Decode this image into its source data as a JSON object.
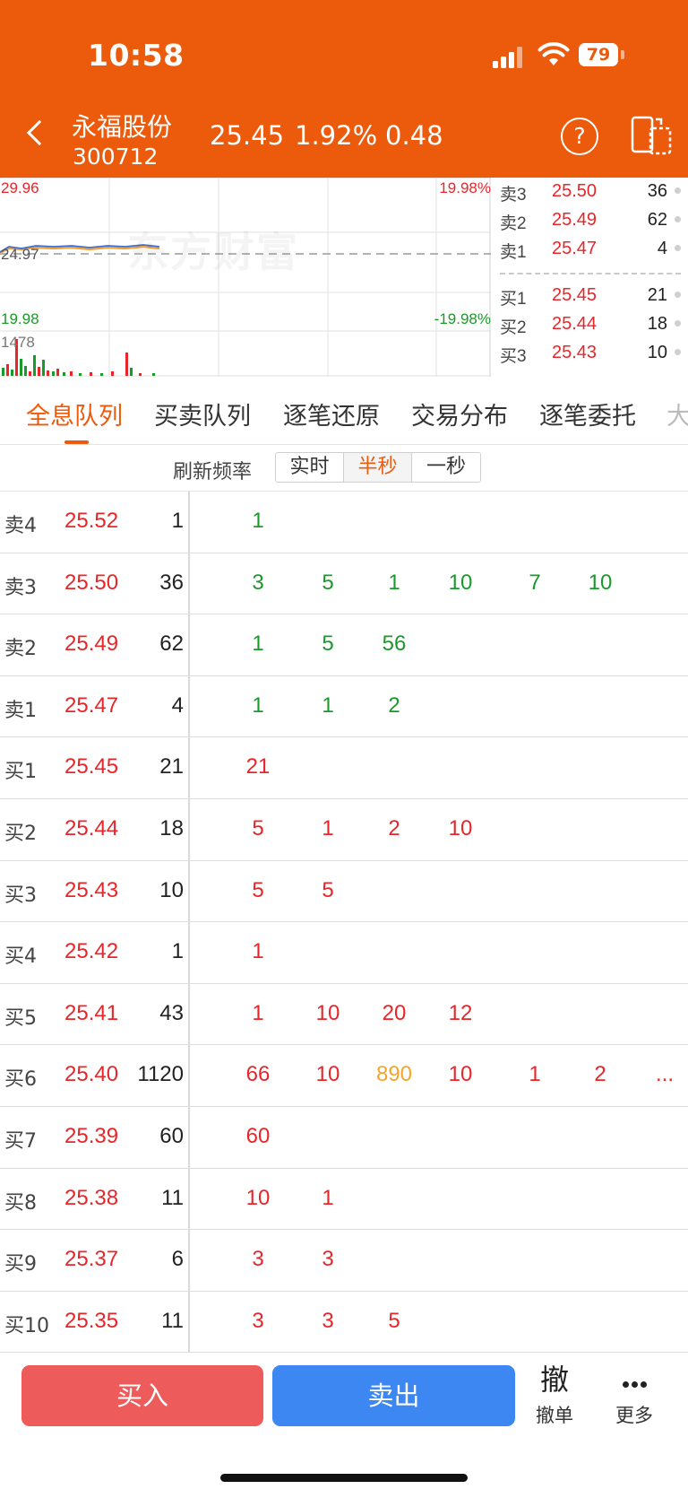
{
  "status_bar": {
    "time": "10:58",
    "battery": "79"
  },
  "header": {
    "name": "永福股份",
    "code": "300712",
    "price": "25.45",
    "change_pct": "1.92%",
    "change": "0.48",
    "help_glyph": "?"
  },
  "mini_chart": {
    "high_price": "29.96",
    "high_pct": "19.98%",
    "pre_close": "24.97",
    "low_price": "19.98",
    "low_pct": "-19.98%",
    "volume_max": "1478",
    "watermark": "东方财富"
  },
  "order_book": {
    "asks": [
      {
        "label": "卖3",
        "price": "25.50",
        "qty": "36"
      },
      {
        "label": "卖2",
        "price": "25.49",
        "qty": "62"
      },
      {
        "label": "卖1",
        "price": "25.47",
        "qty": "4"
      }
    ],
    "bids": [
      {
        "label": "买1",
        "price": "25.45",
        "qty": "21"
      },
      {
        "label": "买2",
        "price": "25.44",
        "qty": "18"
      },
      {
        "label": "买3",
        "price": "25.43",
        "qty": "10"
      }
    ]
  },
  "tabs": [
    "全息队列",
    "买卖队列",
    "逐笔还原",
    "交易分布",
    "逐笔委托",
    "大"
  ],
  "refresh": {
    "label": "刷新频率",
    "options": [
      "实时",
      "半秒",
      "一秒"
    ],
    "selected": "半秒"
  },
  "queue": [
    {
      "label": "卖4",
      "price": "25.52",
      "volume": "1",
      "orders": [
        "1"
      ]
    },
    {
      "label": "卖3",
      "price": "25.50",
      "volume": "36",
      "orders": [
        "3",
        "5",
        "1",
        "10",
        "7",
        "10"
      ]
    },
    {
      "label": "卖2",
      "price": "25.49",
      "volume": "62",
      "orders": [
        "1",
        "5",
        "56"
      ]
    },
    {
      "label": "卖1",
      "price": "25.47",
      "volume": "4",
      "orders": [
        "1",
        "1",
        "2"
      ]
    },
    {
      "label": "买1",
      "price": "25.45",
      "volume": "21",
      "orders": [
        "21"
      ]
    },
    {
      "label": "买2",
      "price": "25.44",
      "volume": "18",
      "orders": [
        "5",
        "1",
        "2",
        "10"
      ]
    },
    {
      "label": "买3",
      "price": "25.43",
      "volume": "10",
      "orders": [
        "5",
        "5"
      ]
    },
    {
      "label": "买4",
      "price": "25.42",
      "volume": "1",
      "orders": [
        "1"
      ]
    },
    {
      "label": "买5",
      "price": "25.41",
      "volume": "43",
      "orders": [
        "1",
        "10",
        "20",
        "12"
      ]
    },
    {
      "label": "买6",
      "price": "25.40",
      "volume": "1120",
      "orders": [
        "66",
        "10",
        "890",
        "10",
        "1",
        "2",
        "..."
      ]
    },
    {
      "label": "买7",
      "price": "25.39",
      "volume": "60",
      "orders": [
        "60"
      ]
    },
    {
      "label": "买8",
      "price": "25.38",
      "volume": "11",
      "orders": [
        "10",
        "1"
      ]
    },
    {
      "label": "买9",
      "price": "25.37",
      "volume": "6",
      "orders": [
        "3",
        "3"
      ]
    },
    {
      "label": "买10",
      "price": "25.35",
      "volume": "11",
      "orders": [
        "3",
        "3",
        "5"
      ]
    }
  ],
  "colors": {
    "brand": "#ec5a0c",
    "up": "#e8262a",
    "down": "#1a9a2a",
    "large_order": "#f5a623",
    "buy_button": "#ee5b5b",
    "sell_button": "#3d87f3"
  },
  "bottom_bar": {
    "buy": "买入",
    "sell": "卖出",
    "cancel_glyph": "撤",
    "cancel": "撤单",
    "more": "更多"
  }
}
